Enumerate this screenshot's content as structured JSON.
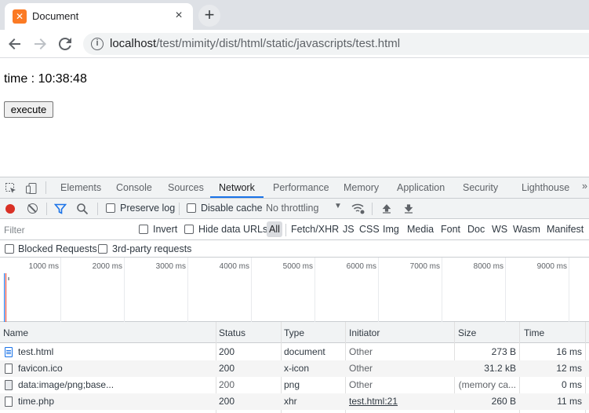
{
  "browser": {
    "tab_title": "Document",
    "tab_close": "×",
    "newtab": "+",
    "url_host": "localhost",
    "url_path": "/test/mimity/dist/html/static/javascripts/test.html"
  },
  "page": {
    "time_text": "time : 10:38:48",
    "execute_label": "execute"
  },
  "devtools": {
    "tabs": [
      "Elements",
      "Console",
      "Sources",
      "Network",
      "Performance",
      "Memory",
      "Application",
      "Security",
      "Lighthouse"
    ],
    "active_tab": "Network",
    "preserve_log": "Preserve log",
    "disable_cache": "Disable cache",
    "throttling": "No throttling",
    "filter_placeholder": "Filter",
    "invert": "Invert",
    "hide_data_urls": "Hide data URLs",
    "type_filters": [
      "All",
      "Fetch/XHR",
      "JS",
      "CSS",
      "Img",
      "Media",
      "Font",
      "Doc",
      "WS",
      "Wasm",
      "Manifest"
    ],
    "blocked_requests": "Blocked Requests",
    "third_party": "3rd-party requests",
    "timeline_ticks": [
      "1000 ms",
      "2000 ms",
      "3000 ms",
      "4000 ms",
      "5000 ms",
      "6000 ms",
      "7000 ms",
      "8000 ms",
      "9000 ms"
    ],
    "columns": [
      "Name",
      "Status",
      "Type",
      "Initiator",
      "Size",
      "Time"
    ],
    "rows": [
      {
        "name": "test.html",
        "status": "200",
        "type": "document",
        "initiator": "Other",
        "size": "273 B",
        "time": "16 ms",
        "icon": "document-icon"
      },
      {
        "name": "favicon.ico",
        "status": "200",
        "type": "x-icon",
        "initiator": "Other",
        "size": "31.2 kB",
        "time": "12 ms",
        "icon": "file-icon"
      },
      {
        "name": "data:image/png;base...",
        "status": "200",
        "type": "png",
        "initiator": "Other",
        "size": "(memory ca...",
        "time": "0 ms",
        "icon": "image-icon"
      },
      {
        "name": "time.php",
        "status": "200",
        "type": "xhr",
        "initiator": "test.html:21",
        "size": "260 B",
        "time": "11 ms",
        "icon": "file-icon"
      }
    ]
  }
}
